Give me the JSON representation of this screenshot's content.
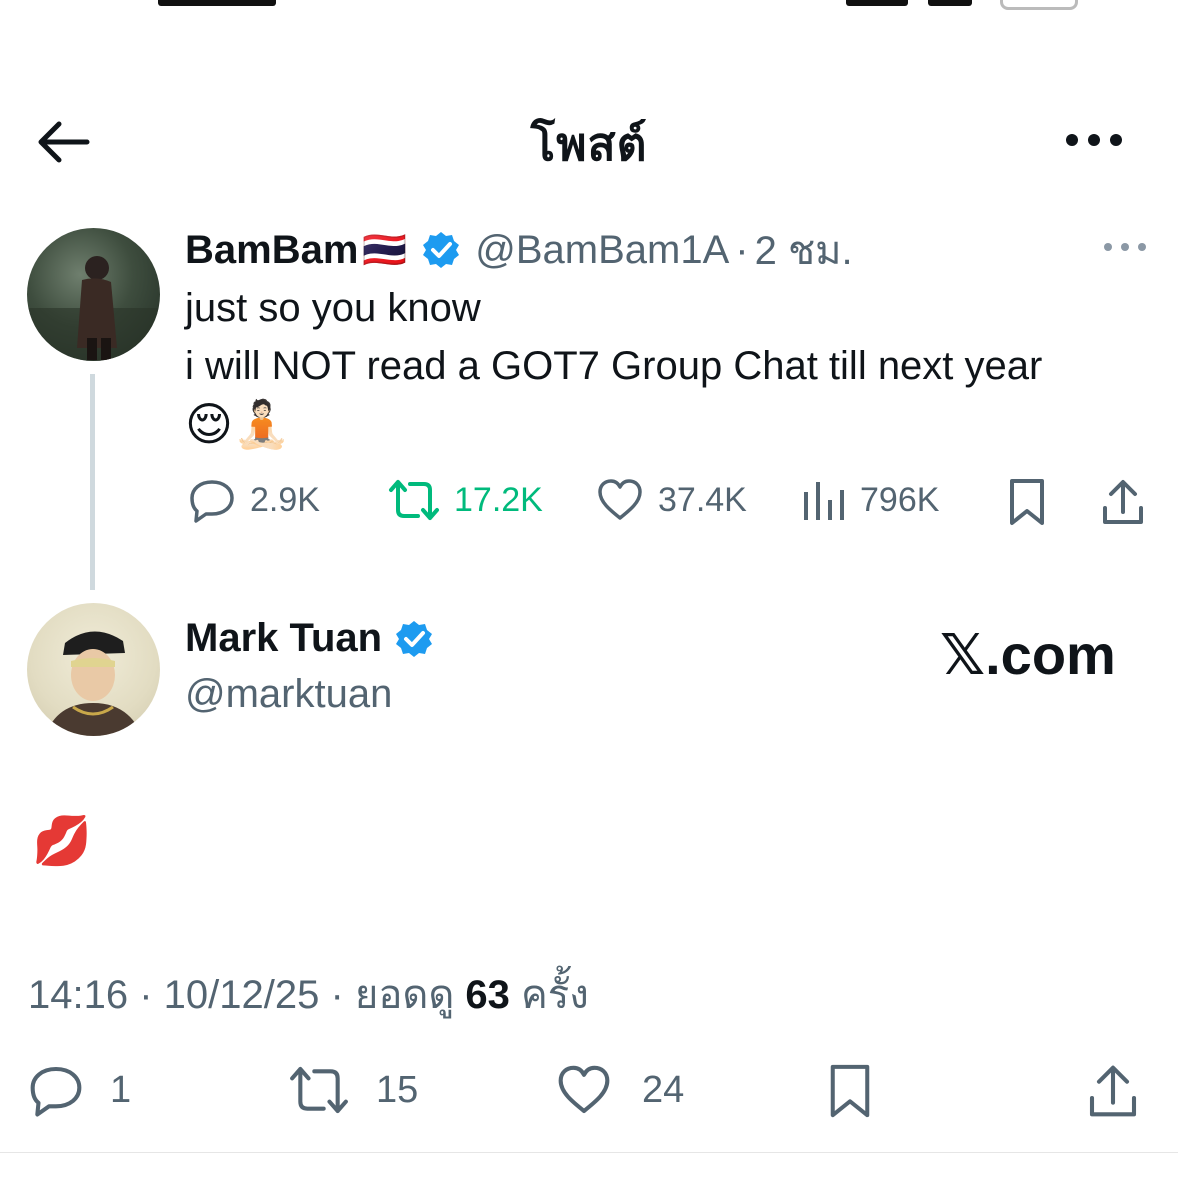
{
  "header": {
    "title": "โพสต์"
  },
  "quoted": {
    "display_name": "BamBam",
    "flag": "🇹🇭",
    "handle": "@BamBam1A",
    "separator": "·",
    "time": "2 ชม.",
    "text_line1": "just so you know",
    "text_line2": "i will NOT read a GOT7 Group Chat till next year",
    "emojis": "😌🧘🏻",
    "replies": "2.9K",
    "reposts": "17.2K",
    "likes": "37.4K",
    "views": "796K"
  },
  "main": {
    "display_name": "Mark Tuan",
    "handle": "@marktuan",
    "source_badge": "𝕏.com",
    "text": "💋",
    "timestamp": "14:16 · 10/12/25 · ยอดดู ",
    "view_count": "63",
    "view_suffix": " ครั้ง",
    "replies": "1",
    "reposts": "15",
    "likes": "24"
  },
  "colors": {
    "verified": "#1d9bf0",
    "repost_active": "#00ba7c",
    "muted": "#536471",
    "thread_line": "#cfd9de"
  }
}
